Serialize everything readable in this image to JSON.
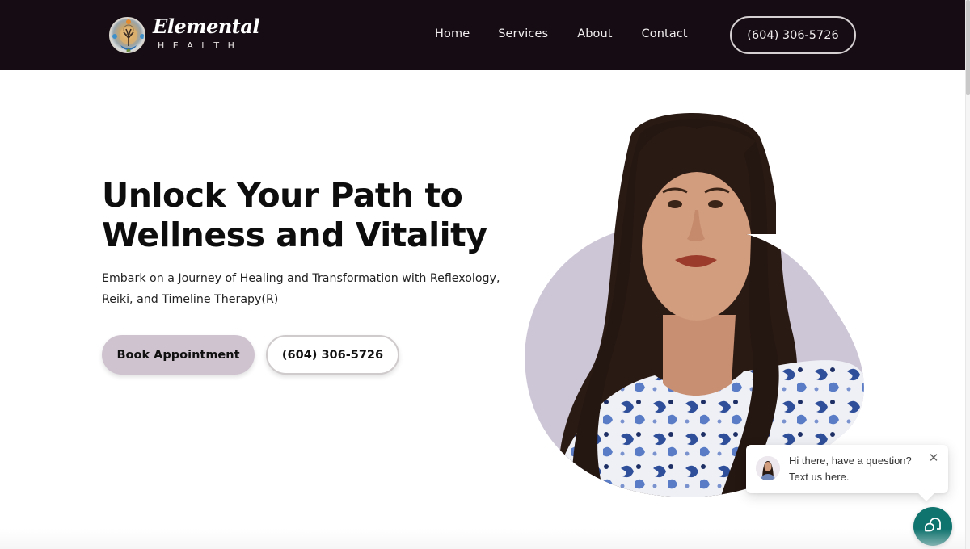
{
  "header": {
    "logo": {
      "wordmark": "Elemental",
      "subtitle": "HEALTH",
      "icon": "tree-of-life-emblem-icon"
    },
    "nav": [
      {
        "label": "Home"
      },
      {
        "label": "Services"
      },
      {
        "label": "About"
      },
      {
        "label": "Contact"
      }
    ],
    "phone_button": "(604) 306-5726"
  },
  "hero": {
    "title": "Unlock Your Path to Wellness and Vitality",
    "subtitle": "Embark on a Journey of Healing and Transformation with Reflexology, Reiki, and Timeline Therapy(R)",
    "primary_button": "Book Appointment",
    "secondary_button": "(604) 306-5726",
    "portrait_alt": "Portrait of practitioner"
  },
  "chat_widget": {
    "line1": "Hi there, have a question?",
    "line2": "Text us here.",
    "close_icon": "close-icon",
    "launcher_icon": "chat-bubbles-icon"
  },
  "colors": {
    "header_bg": "#150d13",
    "accent_lilac": "#cfc3d0",
    "blob_lilac": "#cdc6d6",
    "chat_teal": "#0f736e"
  }
}
